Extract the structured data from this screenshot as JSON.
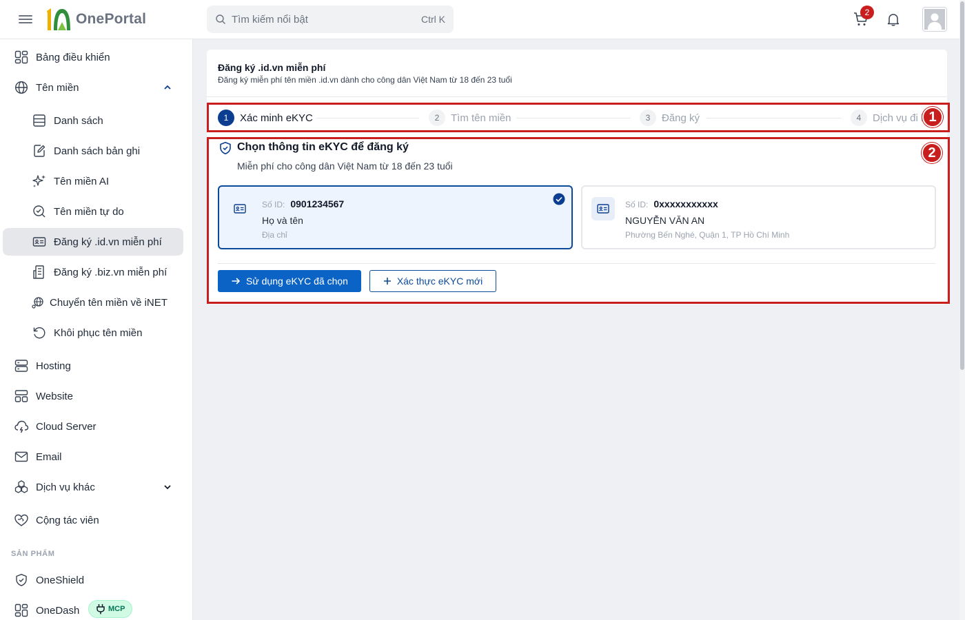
{
  "header": {
    "logo_text": "OnePortal",
    "search_placeholder": "Tìm kiếm nổi bật",
    "search_shortcut": "Ctrl K",
    "cart_count": "2"
  },
  "sidebar": {
    "dashboard": "Bảng điều khiển",
    "domain": "Tên miền",
    "domain_sub": [
      "Danh sách",
      "Danh sách bản ghi",
      "Tên miền AI",
      "Tên miền tự do",
      "Đăng ký .id.vn miễn phí",
      "Đăng ký .biz.vn miễn phí",
      "Chuyển tên miền về iNET",
      "Khôi phục tên miền"
    ],
    "hosting": "Hosting",
    "website": "Website",
    "cloud_server": "Cloud Server",
    "email": "Email",
    "other_services": "Dịch vụ khác",
    "partner": "Cộng tác viên",
    "section_products": "SẢN PHẨM",
    "oneshield": "OneShield",
    "onedash": "OneDash",
    "mcp_badge": "MCP"
  },
  "page": {
    "title": "Đăng ký .id.vn miễn phí",
    "subtitle": "Đăng ký miễn phí tên miền .id.vn dành cho công dân Việt Nam từ 18 đến 23 tuổi"
  },
  "stepper": {
    "steps": [
      {
        "num": "1",
        "label": "Xác minh eKYC"
      },
      {
        "num": "2",
        "label": "Tìm tên miền"
      },
      {
        "num": "3",
        "label": "Đăng ký"
      },
      {
        "num": "4",
        "label": "Dịch vụ đi kèm"
      }
    ],
    "marker": "1"
  },
  "ekyc": {
    "marker": "2",
    "title": "Chọn thông tin eKYC để đăng ký",
    "subtitle": "Miễn phí cho công dân Việt Nam từ 18 đến 23 tuổi",
    "cards": [
      {
        "id_label": "Số ID:",
        "id_value": "0901234567",
        "name": "Họ và tên",
        "address": "Địa chỉ",
        "selected": true
      },
      {
        "id_label": "Số ID:",
        "id_value": "0xxxxxxxxxxx",
        "name": "NGUYỄN VĂN AN",
        "address": "Phường Bến Nghé, Quận 1, TP Hồ Chí Minh",
        "selected": false
      }
    ],
    "use_button": "Sử dụng eKYC đã chọn",
    "new_button": "Xác thực eKYC mới"
  },
  "colors": {
    "primary": "#0b63c5",
    "navy": "#0b3d91",
    "annotation_red": "#c81e1e",
    "logo_green": "#2f8f3a",
    "logo_yellow": "#f0b000"
  }
}
